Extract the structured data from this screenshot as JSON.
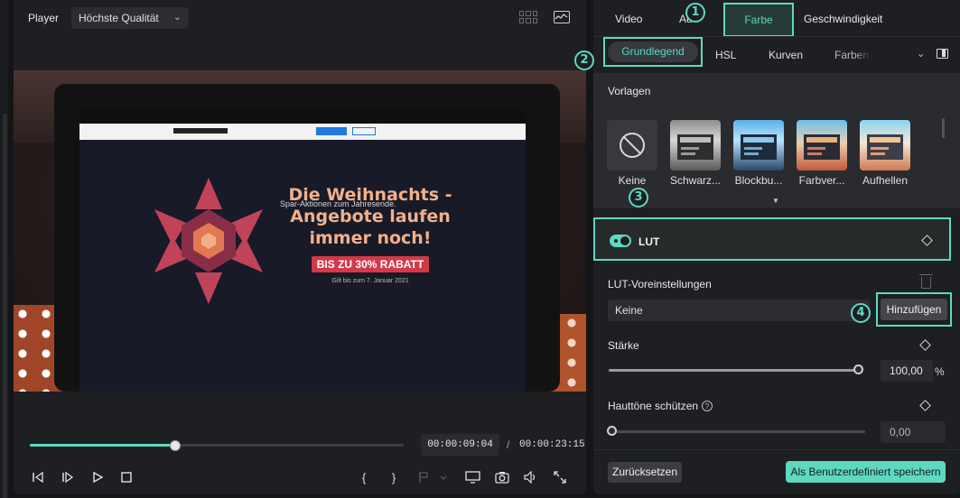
{
  "player": {
    "label": "Player",
    "quality": "Höchste Qualität",
    "current_time": "00:00:09:04",
    "separator": "/",
    "total_time": "00:00:23:15",
    "progress_fraction": 0.39
  },
  "video_frame": {
    "headline": "Die Weihnachts -Angebote laufen immer noch!",
    "subline": "Spar-Aktionen zum Jahresende.",
    "badge": "BIS ZU 30% RABATT",
    "small": "Gilt bis zum 7. Januar 2021"
  },
  "controls": {
    "bracket_in": "{",
    "bracket_out": "}"
  },
  "tabs": {
    "video": "Video",
    "audio": "Au",
    "color": "Farbe",
    "speed": "Geschwindigkeit"
  },
  "subtabs": {
    "basic": "Grundlegend",
    "hsl": "HSL",
    "curves": "Kurven",
    "wheels": "Farben"
  },
  "presets": {
    "title": "Vorlagen",
    "items": [
      {
        "label": "Keine"
      },
      {
        "label": "Schwarz..."
      },
      {
        "label": "Blockbu..."
      },
      {
        "label": "Farbver..."
      },
      {
        "label": "Aufhellen"
      }
    ]
  },
  "lut": {
    "label": "LUT",
    "enabled": true,
    "presets_title": "LUT-Voreinstellungen",
    "selected": "Keine",
    "add_button": "Hinzufügen"
  },
  "strength": {
    "label": "Stärke",
    "value": "100,00",
    "unit": "%",
    "fraction": 1.0
  },
  "skin": {
    "label": "Hauttöne schützen",
    "value": "0,00",
    "fraction": 0.0
  },
  "footer": {
    "reset": "Zurücksetzen",
    "save": "Als Benutzerdefiniert speichern"
  },
  "callouts": [
    "1",
    "2",
    "3",
    "4"
  ],
  "colors": {
    "accent": "#5ed8c0",
    "panel": "#1e1f22",
    "background": "#141517"
  }
}
